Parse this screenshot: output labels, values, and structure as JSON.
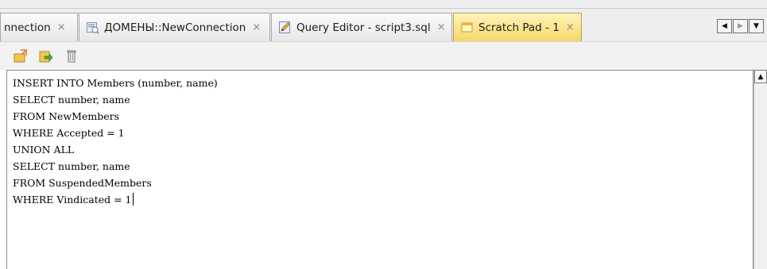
{
  "tabs": [
    {
      "label": "nnection",
      "close": "×",
      "icon": "connection-icon",
      "active": false
    },
    {
      "label": "ДОМЕНЫ::NewConnection",
      "close": "×",
      "icon": "database-connection-icon",
      "active": false
    },
    {
      "label": "Query Editor - script3.sql",
      "close": "×",
      "icon": "pencil-edit-icon",
      "active": false
    },
    {
      "label": "Scratch Pad - 1",
      "close": "×",
      "icon": "notepad-icon",
      "active": true
    }
  ],
  "tab_nav": {
    "left": "◀",
    "right": "▶",
    "menu": "▼"
  },
  "toolbar": {
    "buttons": [
      {
        "icon": "load-file-icon"
      },
      {
        "icon": "export-arrow-icon"
      },
      {
        "icon": "trash-can-icon"
      }
    ]
  },
  "editor": {
    "lines": [
      "INSERT INTO Members (number, name)",
      "SELECT number, name",
      "FROM NewMembers",
      "WHERE Accepted = 1",
      "UNION ALL",
      "SELECT number, name",
      "FROM SuspendedMembers",
      "WHERE Vindicated = 1"
    ]
  },
  "scrollbar": {
    "up_arrow": "▲"
  },
  "colors": {
    "active_tab": "#f6d768",
    "tab_border": "#a8a8a8",
    "editor_border": "#8a8a8a",
    "background": "#eeeeee"
  }
}
